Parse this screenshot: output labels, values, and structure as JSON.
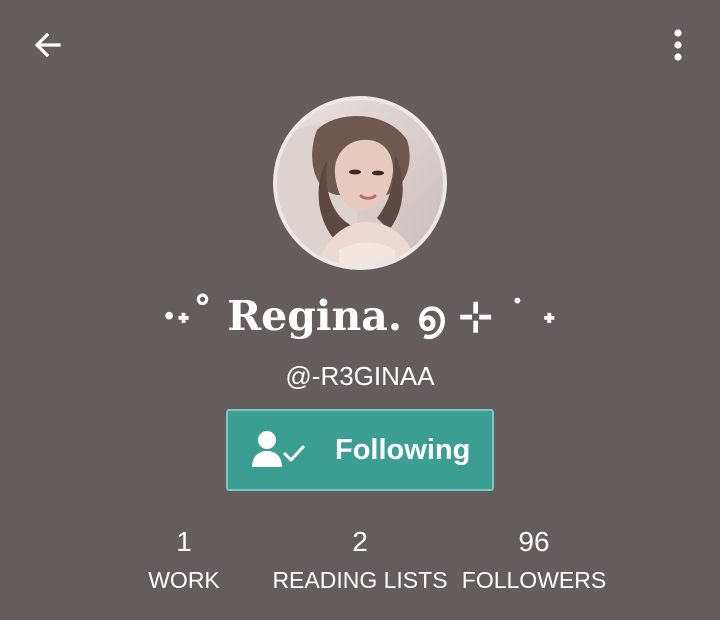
{
  "header": {
    "back_icon": "arrow-left-icon",
    "menu_icon": "more-vertical-icon"
  },
  "profile": {
    "avatar_icon": "profile-photo",
    "display_name": "·˖˚ Regina. ൭ ⊹ ˙ ˖",
    "username": "@-R3GINAA"
  },
  "follow_button": {
    "icon": "user-check-icon",
    "label": "Following",
    "color": "#3a9e93"
  },
  "stats": [
    {
      "count": "1",
      "label": "WORK"
    },
    {
      "count": "2",
      "label": "READING LISTS"
    },
    {
      "count": "96",
      "label": "FOLLOWERS"
    }
  ],
  "colors": {
    "background": "#655d5d",
    "text": "#ffffff",
    "accent": "#3a9e93"
  }
}
